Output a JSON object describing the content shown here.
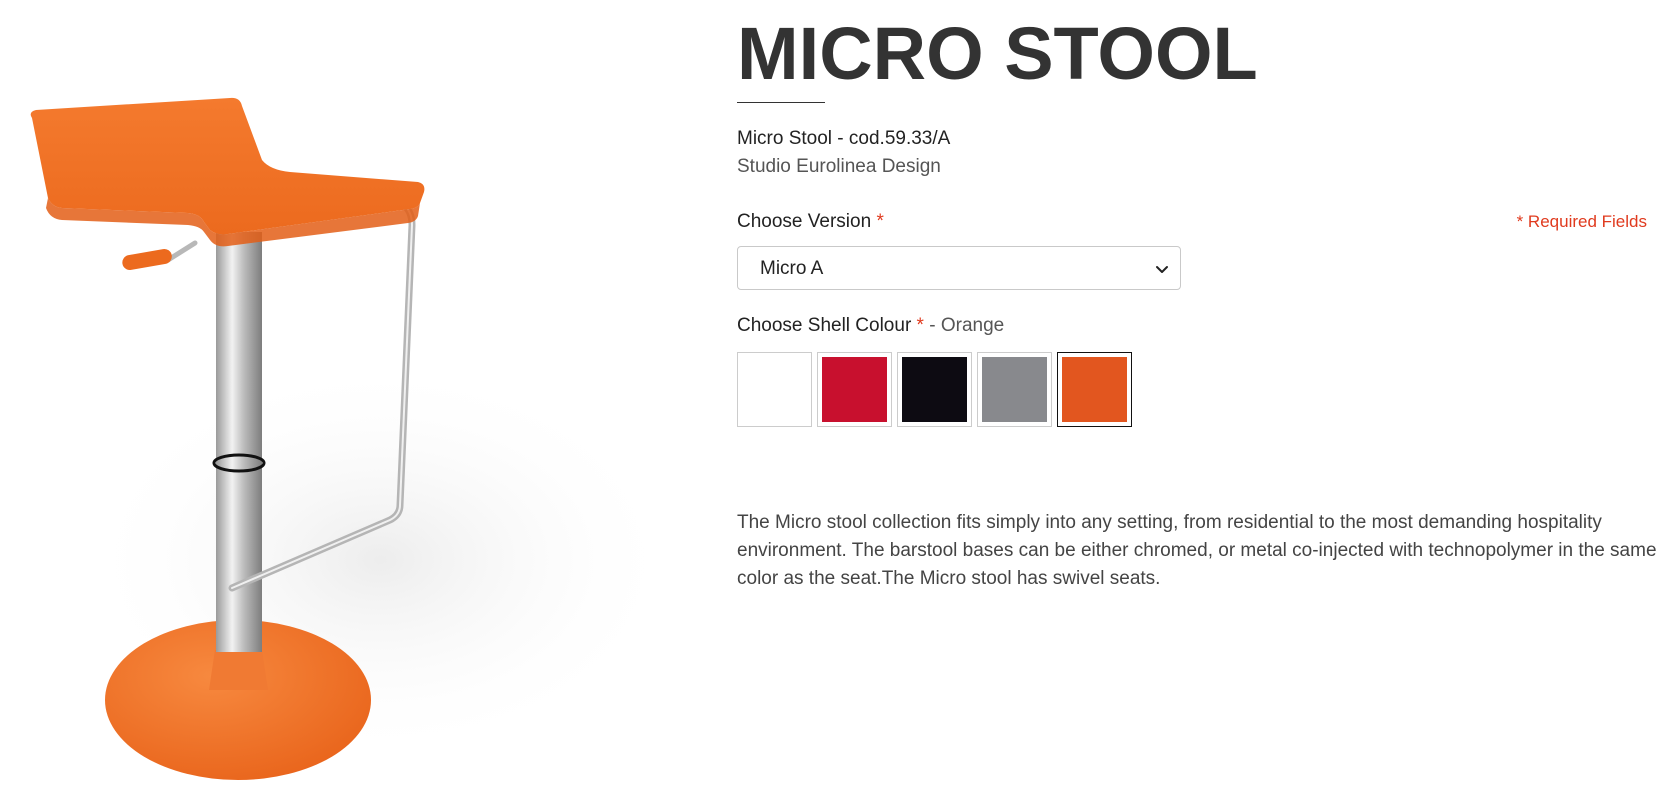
{
  "product": {
    "title": "MICRO STOOL",
    "code_line": "Micro Stool - cod.59.33/A",
    "designer": "Studio Eurolinea Design",
    "description": "The Micro stool collection fits simply into any setting, from residential to the most demanding hospitality environment. The barstool bases can be either chromed, or metal co-injected with technopolymer in the same color as the seat.The Micro stool has swivel seats."
  },
  "version": {
    "label": "Choose Version",
    "required_marker": "*",
    "selected": "Micro A"
  },
  "required_note": "* Required Fields",
  "shell_colour": {
    "label": "Choose Shell Colour",
    "required_marker": "*",
    "selected_text": "- Orange",
    "swatches": [
      {
        "color": "#ffffff",
        "selected": false
      },
      {
        "color": "#c8102e",
        "selected": false
      },
      {
        "color": "#0d0b12",
        "selected": false
      },
      {
        "color": "#88898d",
        "selected": false
      },
      {
        "color": "#e2561f",
        "selected": true
      }
    ]
  },
  "colors": {
    "accent_required": "#e03a1e",
    "stool_orange": "#f26a21",
    "chrome": "#c9c9c9"
  },
  "icons": {
    "select_chevron": "chevron-down-icon"
  }
}
